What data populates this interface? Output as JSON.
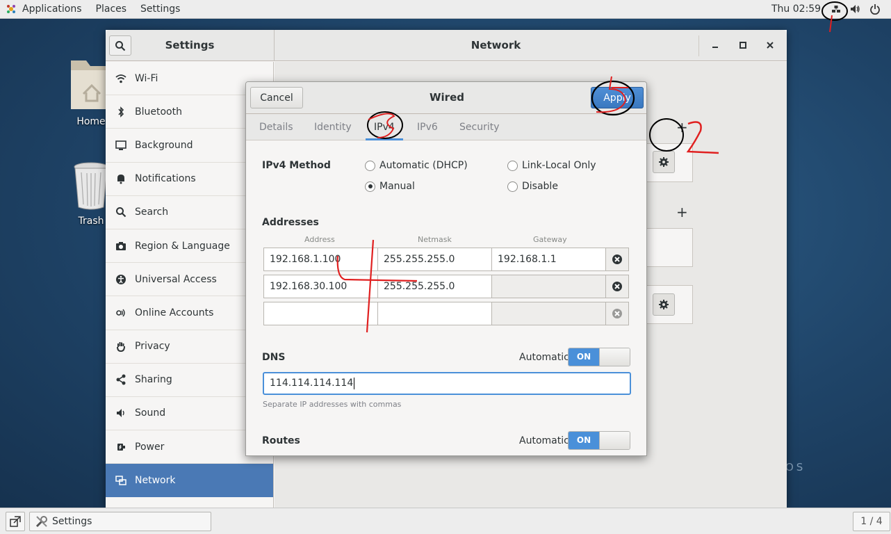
{
  "topbar": {
    "applications": "Applications",
    "places": "Places",
    "settings": "Settings",
    "clock": "Thu 02:59",
    "icons": [
      "network-wired-icon",
      "volume-icon",
      "power-icon"
    ]
  },
  "desktop": {
    "home_label": "Home",
    "trash_label": "Trash",
    "watermark": "OS"
  },
  "settings_window": {
    "left_title": "Settings",
    "right_title": "Network",
    "sidebar": [
      {
        "label": "Wi-Fi",
        "icon": "wifi-icon"
      },
      {
        "label": "Bluetooth",
        "icon": "bluetooth-icon"
      },
      {
        "label": "Background",
        "icon": "background-icon"
      },
      {
        "label": "Notifications",
        "icon": "bell-icon"
      },
      {
        "label": "Search",
        "icon": "search-icon"
      },
      {
        "label": "Region & Language",
        "icon": "camera-icon"
      },
      {
        "label": "Universal Access",
        "icon": "accessibility-icon"
      },
      {
        "label": "Online Accounts",
        "icon": "online-accounts-icon"
      },
      {
        "label": "Privacy",
        "icon": "hand-icon"
      },
      {
        "label": "Sharing",
        "icon": "share-icon"
      },
      {
        "label": "Sound",
        "icon": "speaker-icon"
      },
      {
        "label": "Power",
        "icon": "power-plug-icon"
      },
      {
        "label": "Network",
        "icon": "network-icon",
        "selected": true
      }
    ]
  },
  "dialog": {
    "title": "Wired",
    "cancel": "Cancel",
    "apply": "Apply",
    "tabs": [
      "Details",
      "Identity",
      "IPv4",
      "IPv6",
      "Security"
    ],
    "active_tab": "IPv4",
    "method_label": "IPv4 Method",
    "methods": {
      "dhcp": "Automatic (DHCP)",
      "manual": "Manual",
      "link_local": "Link-Local Only",
      "disable": "Disable"
    },
    "selected_method": "Manual",
    "addresses_label": "Addresses",
    "columns": [
      "Address",
      "Netmask",
      "Gateway"
    ],
    "rows": [
      {
        "address": "192.168.1.100",
        "netmask": "255.255.255.0",
        "gateway": "192.168.1.1"
      },
      {
        "address": "192.168.30.100",
        "netmask": "255.255.255.0",
        "gateway": ""
      },
      {
        "address": "",
        "netmask": "",
        "gateway": ""
      }
    ],
    "dns_label": "DNS",
    "automatic_label": "Automatic",
    "toggle_on": "ON",
    "dns_value": "114.114.114.114",
    "dns_hint": "Separate IP addresses with commas",
    "routes_label": "Routes"
  },
  "taskbar": {
    "window_label": "Settings",
    "workspace": "1 / 4"
  },
  "annotations": [
    "1",
    "2",
    "3",
    "4",
    "5"
  ],
  "colors": {
    "accent": "#4a90d9",
    "selected_row": "#4a79b5",
    "annotation_red": "#e02020",
    "annotation_black": "#000000"
  }
}
